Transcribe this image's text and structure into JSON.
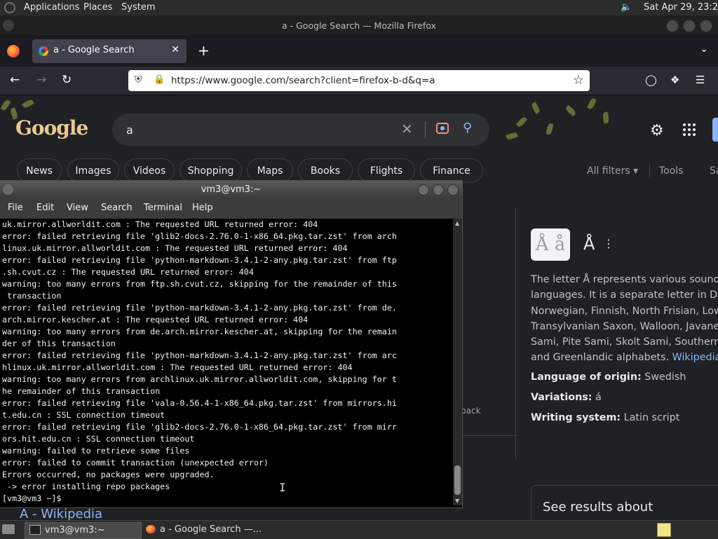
{
  "panel": {
    "menus": [
      "Applications",
      "Places",
      "System"
    ],
    "clock": "Sat Apr 29, 23:21"
  },
  "firefox": {
    "window_title": "a - Google Search — Mozilla Firefox",
    "tab_label": "a - Google Search",
    "url": "https://www.google.com/search?client=firefox-b-d&q=a"
  },
  "google": {
    "logo": "Google",
    "query": "a",
    "chips": [
      "News",
      "Images",
      "Videos",
      "Shopping",
      "Maps",
      "Books",
      "Flights",
      "Finance"
    ],
    "all_filters": "All filters",
    "tools": "Tools",
    "sa_partial": "Sa",
    "kp": {
      "thumb": "Å å",
      "title": "Å",
      "description": "The letter Å represents various sounds in several languages. It is a separate letter in Danish, Swedish, Norwegian, Finnish, North Frisian, Low Saxon, Transylvanian Saxon, Walloon, Javanese, Chamorro, Lule Sami, Pite Sami, Skolt Sami, Southern Sami, and Greenlandic alphabets.",
      "desc_lines": [
        "The letter Å represents various sounds in se",
        "languages. It is a separate letter in Danish,",
        "Norwegian, Finnish, North Frisian, Low Sax",
        "Transylvanian Saxon, Walloon, Javanese, C",
        "Sami, Pite Sami, Skolt Sami, Southern Sam",
        "and Greenlandic alphabets."
      ],
      "wiki_link": "Wikipedia",
      "facts": [
        {
          "label": "Language of origin:",
          "value": "Swedish"
        },
        {
          "label": "Variations:",
          "value": "á"
        },
        {
          "label": "Writing system:",
          "value": "Latin script"
        }
      ]
    },
    "feedback_partial": "back",
    "see_results": "See results about",
    "result_link": "A - Wikipedia"
  },
  "terminal": {
    "title": "vm3@vm3:~",
    "menus": [
      "File",
      "Edit",
      "View",
      "Search",
      "Terminal",
      "Help"
    ],
    "lines": [
      "uk.mirror.allworldit.com : The requested URL returned error: 404",
      "error: failed retrieving file 'glib2-docs-2.76.0-1-x86_64.pkg.tar.zst' from arch",
      "linux.uk.mirror.allworldit.com : The requested URL returned error: 404",
      "error: failed retrieving file 'python-markdown-3.4.1-2-any.pkg.tar.zst' from ftp",
      ".sh.cvut.cz : The requested URL returned error: 404",
      "warning: too many errors from ftp.sh.cvut.cz, skipping for the remainder of this",
      " transaction",
      "error: failed retrieving file 'python-markdown-3.4.1-2-any.pkg.tar.zst' from de.",
      "arch.mirror.kescher.at : The requested URL returned error: 404",
      "warning: too many errors from de.arch.mirror.kescher.at, skipping for the remain",
      "der of this transaction",
      "error: failed retrieving file 'python-markdown-3.4.1-2-any.pkg.tar.zst' from arc",
      "hlinux.uk.mirror.allworldit.com : The requested URL returned error: 404",
      "warning: too many errors from archlinux.uk.mirror.allworldit.com, skipping for t",
      "he remainder of this transaction",
      "error: failed retrieving file 'vala-0.56.4-1-x86_64.pkg.tar.zst' from mirrors.hi",
      "t.edu.cn : SSL connection timeout",
      "error: failed retrieving file 'glib2-docs-2.76.0-1-x86_64.pkg.tar.zst' from mirr",
      "ors.hit.edu.cn : SSL connection timeout",
      "warning: failed to retrieve some files",
      "error: failed to commit transaction (unexpected error)",
      "Errors occurred, no packages were upgraded.",
      " -> error installing repo packages",
      "[vm3@vm3 ~]$ "
    ]
  },
  "taskbar": {
    "items": [
      "vm3@vm3:~",
      "a - Google Search —..."
    ]
  },
  "icons": {
    "settings": "gear-icon",
    "apps": "apps-grid-icon",
    "search": "search-icon",
    "clear": "close-icon",
    "lens": "lens-icon"
  }
}
